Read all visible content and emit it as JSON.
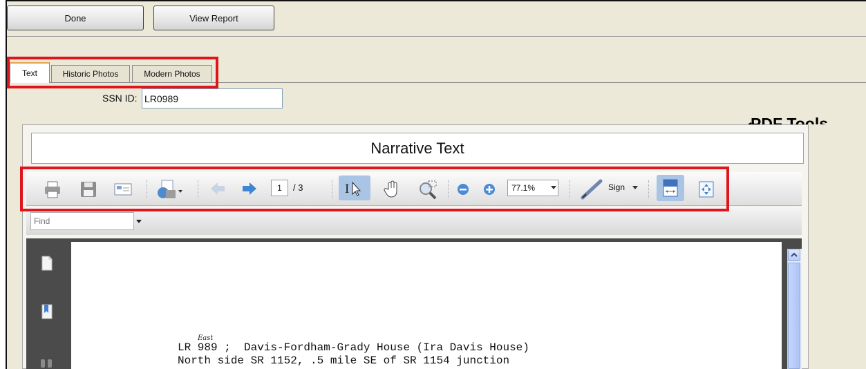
{
  "toolbar": {
    "done_label": "Done",
    "view_report_label": "View Report"
  },
  "tabs": [
    {
      "label": "Text",
      "active": true
    },
    {
      "label": "Historic Photos",
      "active": false
    },
    {
      "label": "Modern Photos",
      "active": false
    }
  ],
  "ssn": {
    "label": "SSN ID:",
    "value": "LR0989"
  },
  "annotation": {
    "pdf_tools_label": "PDF Tools"
  },
  "viewer": {
    "panel_title": "Narrative Text",
    "page_current": "1",
    "page_total": "/ 3",
    "zoom": "77.1%",
    "sign_label": "Sign",
    "find_placeholder": "Find"
  },
  "document": {
    "line1": "LR 989 ;  Davis-Fordham-Grady House (Ira Davis House)",
    "line2": "North side SR 1152, .5 mile SE of SR 1154 junction",
    "handwritten_insert": "East"
  },
  "colors": {
    "highlight_red": "#e0141b",
    "tab_accent": "#e8a24a",
    "page_bg": "#ece9d8"
  }
}
